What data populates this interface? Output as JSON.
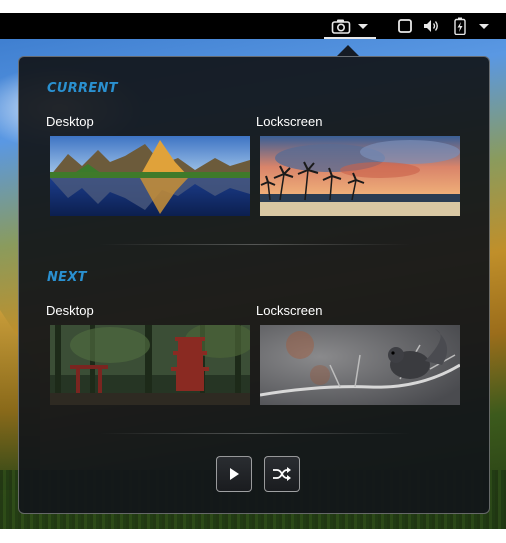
{
  "topbar": {
    "icons": [
      "camera-icon",
      "chevron-down-icon",
      "window-icon",
      "volume-icon",
      "battery-icon",
      "chevron-down-icon"
    ]
  },
  "current": {
    "title": "CURRENT",
    "desktop_label": "Desktop",
    "lockscreen_label": "Lockscreen"
  },
  "next": {
    "title": "NEXT",
    "desktop_label": "Desktop",
    "lockscreen_label": "Lockscreen"
  },
  "controls": {
    "play_icon": "play-icon",
    "shuffle_icon": "shuffle-icon"
  },
  "colors": {
    "accent": "#2a90d0",
    "panel_bg": "#12151a",
    "topbar_bg": "#000000"
  }
}
